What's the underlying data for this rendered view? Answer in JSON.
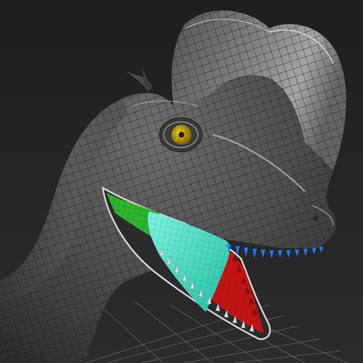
{
  "viewport": {
    "background": "#262626",
    "floor_grid_color": "#8a8a8a",
    "wireframe_color": "#1a1a1a"
  },
  "model": {
    "subject": "dinosaur-head-crest-wireframe",
    "skin_color": "#5a5a5a",
    "eye_color": "#c9a000",
    "tongue_color": "#3fe6c8",
    "gum_upper_color": "#2db52d",
    "gum_lower_color": "#c41414",
    "teeth_upper_color": "#1e78ff",
    "teeth_lower_color": "#cfcfcf"
  }
}
